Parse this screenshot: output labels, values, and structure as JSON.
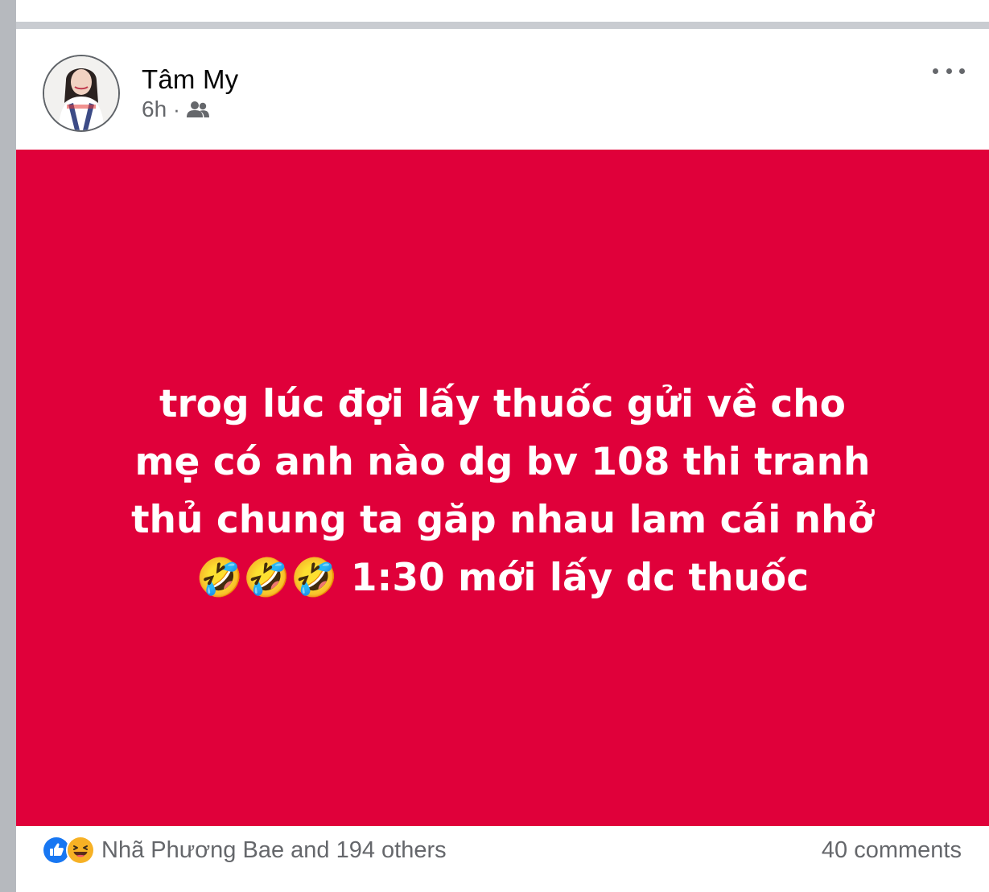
{
  "post": {
    "author_name": "Tâm My",
    "timestamp": "6h",
    "separator": "·",
    "audience_icon": "friends-icon",
    "more_icon": "more-options-icon",
    "body_text_lines": [
      "trog lúc đợi lấy thuốc gửi về cho",
      "mẹ có anh nào dg bv 108 thi tranh",
      "thủ chung ta găp nhau lam cái nhở",
      "🤣🤣🤣 1:30 mới lấy dc thuốc"
    ],
    "background_color": "#e0003a",
    "text_color": "#ffffff"
  },
  "footer": {
    "reaction_icons": [
      "like-icon",
      "haha-icon"
    ],
    "reactions_text": "Nhã Phương Bae and 194 others",
    "comments_text": "40 comments"
  },
  "colors": {
    "like_blue": "#1877f2",
    "haha_yellow": "#f7b125",
    "secondary_text": "#65676b",
    "primary_text": "#050505"
  }
}
